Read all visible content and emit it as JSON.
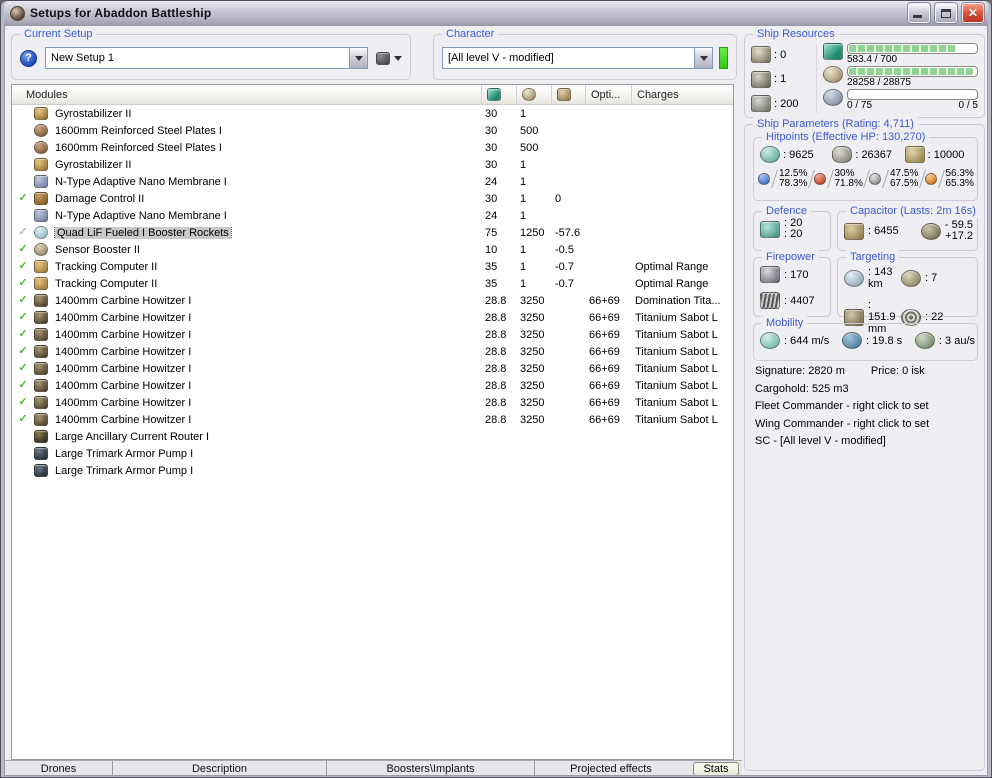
{
  "window": {
    "title": "Setups for Abaddon Battleship",
    "min_label": "minimize",
    "max_label": "maximize",
    "close_label": "close"
  },
  "current_setup": {
    "label": "Current Setup",
    "value": "New Setup 1"
  },
  "character": {
    "label": "Character",
    "value": "[All level V - modified]"
  },
  "modules": {
    "header": {
      "name": "Modules",
      "opti": "Opti...",
      "charges": "Charges"
    },
    "rows": [
      {
        "name": "Gyrostabilizer II",
        "icon": "gyrostabilizer",
        "cpu": "30",
        "pg": "1",
        "cap": "",
        "opti": "",
        "charge": "",
        "check": "",
        "selected": false
      },
      {
        "name": "1600mm Reinforced Steel Plates I",
        "icon": "armor-plate",
        "cpu": "30",
        "pg": "500",
        "cap": "",
        "opti": "",
        "charge": "",
        "check": "",
        "selected": false
      },
      {
        "name": "1600mm Reinforced Steel Plates I",
        "icon": "armor-plate",
        "cpu": "30",
        "pg": "500",
        "cap": "",
        "opti": "",
        "charge": "",
        "check": "",
        "selected": false
      },
      {
        "name": "Gyrostabilizer II",
        "icon": "gyrostabilizer",
        "cpu": "30",
        "pg": "1",
        "cap": "",
        "opti": "",
        "charge": "",
        "check": "",
        "selected": false
      },
      {
        "name": "N-Type Adaptive Nano Membrane I",
        "icon": "membrane",
        "cpu": "24",
        "pg": "1",
        "cap": "",
        "opti": "",
        "charge": "",
        "check": "",
        "selected": false
      },
      {
        "name": "Damage Control II",
        "icon": "damage-control",
        "cpu": "30",
        "pg": "1",
        "cap": "0",
        "opti": "",
        "charge": "",
        "check": "yes",
        "selected": false
      },
      {
        "name": "N-Type Adaptive Nano Membrane I",
        "icon": "membrane",
        "cpu": "24",
        "pg": "1",
        "cap": "",
        "opti": "",
        "charge": "",
        "check": "",
        "selected": false
      },
      {
        "name": "Quad LiF Fueled I Booster Rockets",
        "icon": "booster",
        "cpu": "75",
        "pg": "1250",
        "cap": "-57.6",
        "opti": "",
        "charge": "",
        "check": "faded",
        "selected": true
      },
      {
        "name": "Sensor Booster II",
        "icon": "sensor-booster",
        "cpu": "10",
        "pg": "1",
        "cap": "-0.5",
        "opti": "",
        "charge": "",
        "check": "yes",
        "selected": false
      },
      {
        "name": "Tracking Computer II",
        "icon": "tracking-computer",
        "cpu": "35",
        "pg": "1",
        "cap": "-0.7",
        "opti": "",
        "charge": "Optimal Range",
        "check": "yes",
        "selected": false
      },
      {
        "name": "Tracking Computer II",
        "icon": "tracking-computer",
        "cpu": "35",
        "pg": "1",
        "cap": "-0.7",
        "opti": "",
        "charge": "Optimal Range",
        "check": "yes",
        "selected": false
      },
      {
        "name": "1400mm Carbine Howitzer I",
        "icon": "howitzer",
        "cpu": "28.8",
        "pg": "3250",
        "cap": "",
        "opti": "66+69",
        "charge": "Domination Tita...",
        "check": "yes",
        "selected": false
      },
      {
        "name": "1400mm Carbine Howitzer I",
        "icon": "howitzer",
        "cpu": "28.8",
        "pg": "3250",
        "cap": "",
        "opti": "66+69",
        "charge": "Titanium Sabot L",
        "check": "yes",
        "selected": false
      },
      {
        "name": "1400mm Carbine Howitzer I",
        "icon": "howitzer",
        "cpu": "28.8",
        "pg": "3250",
        "cap": "",
        "opti": "66+69",
        "charge": "Titanium Sabot L",
        "check": "yes",
        "selected": false
      },
      {
        "name": "1400mm Carbine Howitzer I",
        "icon": "howitzer",
        "cpu": "28.8",
        "pg": "3250",
        "cap": "",
        "opti": "66+69",
        "charge": "Titanium Sabot L",
        "check": "yes",
        "selected": false
      },
      {
        "name": "1400mm Carbine Howitzer I",
        "icon": "howitzer",
        "cpu": "28.8",
        "pg": "3250",
        "cap": "",
        "opti": "66+69",
        "charge": "Titanium Sabot L",
        "check": "yes",
        "selected": false
      },
      {
        "name": "1400mm Carbine Howitzer I",
        "icon": "howitzer",
        "cpu": "28.8",
        "pg": "3250",
        "cap": "",
        "opti": "66+69",
        "charge": "Titanium Sabot L",
        "check": "yes",
        "selected": false
      },
      {
        "name": "1400mm Carbine Howitzer I",
        "icon": "howitzer",
        "cpu": "28.8",
        "pg": "3250",
        "cap": "",
        "opti": "66+69",
        "charge": "Titanium Sabot L",
        "check": "yes",
        "selected": false
      },
      {
        "name": "1400mm Carbine Howitzer I",
        "icon": "howitzer",
        "cpu": "28.8",
        "pg": "3250",
        "cap": "",
        "opti": "66+69",
        "charge": "Titanium Sabot L",
        "check": "yes",
        "selected": false
      },
      {
        "name": "Large Ancillary Current Router I",
        "icon": "rig-router",
        "cpu": "",
        "pg": "",
        "cap": "",
        "opti": "",
        "charge": "",
        "check": "",
        "selected": false
      },
      {
        "name": "Large Trimark Armor Pump I",
        "icon": "rig-trimark",
        "cpu": "",
        "pg": "",
        "cap": "",
        "opti": "",
        "charge": "",
        "check": "",
        "selected": false
      },
      {
        "name": "Large Trimark Armor Pump I",
        "icon": "rig-trimark",
        "cpu": "",
        "pg": "",
        "cap": "",
        "opti": "",
        "charge": "",
        "check": "",
        "selected": false
      }
    ]
  },
  "tabs": {
    "items": [
      "Drones",
      "Description",
      "Boosters\\Implants",
      "Projected effects"
    ],
    "stats_button": "Stats"
  },
  "ship_resources": {
    "label": "Ship Resources",
    "turrets": ": 0",
    "launchers": ": 1",
    "calibration": ": 200",
    "cpu": {
      "text": "583.4 / 700",
      "pct": 84
    },
    "powergrid": {
      "text": "28258 / 28875",
      "pct": 98
    },
    "drones": {
      "left": "0 / 75",
      "right": "0 / 5",
      "pct": 0
    }
  },
  "ship_parameters": {
    "label": "Ship Parameters (Rating: 4,711)",
    "hitpoints": {
      "label": "Hitpoints (Effective HP: 130,270)",
      "shield": ": 9625",
      "armor": ": 26367",
      "hull": ": 10000",
      "resists": [
        {
          "icon": "em",
          "top": "12.5%",
          "bottom": "78.3%"
        },
        {
          "icon": "thermal",
          "top": "30%",
          "bottom": "71.8%"
        },
        {
          "icon": "kinetic",
          "top": "47.5%",
          "bottom": "67.5%"
        },
        {
          "icon": "explosive",
          "top": "56.3%",
          "bottom": "65.3%"
        }
      ]
    },
    "defence": {
      "label": "Defence",
      "v1": ": 20",
      "v2": ": 20"
    },
    "capacitor": {
      "label": "Capacitor (Lasts: 2m 16s)",
      "amount": ": 6455",
      "delta_out": "- 59.5",
      "delta_in": "+17.2"
    },
    "firepower": {
      "label": "Firepower",
      "turret": ": 170",
      "volley": ": 4407"
    },
    "targeting": {
      "label": "Targeting",
      "range": ": 143 km",
      "max_targets": ": 7",
      "scan_res": ": 151.9 mm",
      "sensor_strength": ": 22"
    },
    "mobility": {
      "label": "Mobility",
      "speed": ": 644 m/s",
      "align": ": 19.8 s",
      "warp": ": 3 au/s"
    },
    "info": {
      "signature": "Signature: 2820 m",
      "price": "Price: 0 isk",
      "cargohold": "Cargohold: 525 m3",
      "fleet": "Fleet Commander - right click to set",
      "wing": "Wing Commander - right click to set",
      "sc": "SC - [All level V - modified]"
    }
  }
}
